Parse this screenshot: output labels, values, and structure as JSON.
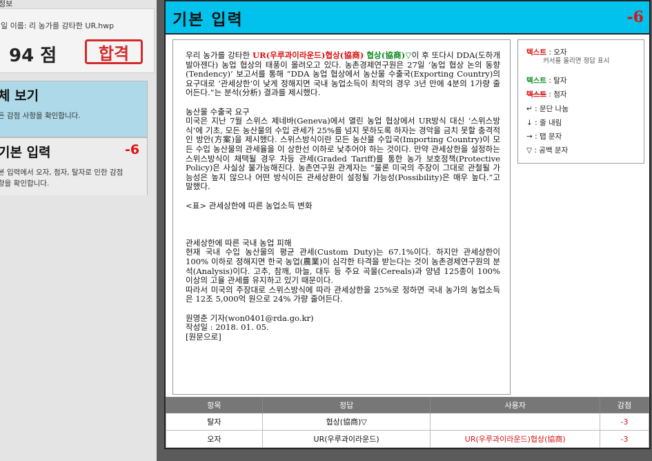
{
  "sidebar": {
    "header": "정보",
    "file_name": "일 이름: 리 농가를 강타한 UR.hwp",
    "score": "94 점",
    "stamp": "합격",
    "card_all": {
      "title": "체 보기",
      "desc": "든 감점 사항을 확인합니다."
    },
    "card_basic": {
      "title": "기본 입력",
      "score": "-6",
      "desc1": "본 입력에서 오자, 첨자, 탈자로 인한 감점",
      "desc2": "항을 확인합니다."
    }
  },
  "main": {
    "title": "기본 입력",
    "penalty": "-6"
  },
  "doc": {
    "p1_a": "우리 농가를 강타한 ",
    "p1_err": "UR(우루과이라운드)협상(協商)",
    "p1_sp": " ",
    "p1_err2": "협상(協商)▽",
    "p1_b": "이 후 또다시 DDA(도하개발아젠다) 농업 협상의 태풍이 몰려오고 있다. 농촌경제연구원은 27일 ‘농업 협상 논의 동향(Tendency)’ 보고서를 통해 “DDA 농업 협상에서 농산물 수출국(Exporting Country)의 요구대로 ‘관세상한’이 낮게 정해지면 국내 농업소득이 최악의 경우 3년 만에 4분의 1가량 줄어든다.”는 분석(分析) 결과를 제시했다.",
    "p2": "농산물 수출국 요구",
    "p3": "미국은 지난 7월 스위스 제네바(Geneva)에서 열린 농업 협상에서 UR방식 대신 ‘스위스방식’에 기초, 모든 농산물의 수입 관세가 25%를 넘지 못하도록 하자는 경악을 금치 못할 충격적인 방안(方案)을 제시했다. 스위스방식이란 모든 농산물 수입국(Importing Country)이 모든 수입 농산물의 관세율을 이 상한선 이하로 낮추어야 하는 것이다. 만약 관세상한을 설정하는 스위스방식이 채택될 경우 차등 관세(Graded Tariff)를 통한 농가 보호정책(Protective Policy)은 사실상 불가능해진다. 농촌연구원 관계자는 “물론 미국의 주장이 그대로 관철될 가능성은 높지 않으나 어떤 방식이든 관세상환이 설정될 가능성(Possibility)은 매우 높다.”고 말했다.",
    "p4": "<표> 관세상한에 따른 농업소득 변화",
    "p5": "관세상한에 따른 국내 농업 피해",
    "p6": "현재 국내 수입 농산물의 평균 관세(Custom Duty)는 67.1%이다. 하지만 관세상한이 100% 이하로 정해지면 한국 농업(農業)이 심각한 타격을 받는다는 것이 농촌경제연구원의 분석(Analysis)이다. 고추, 참깨, 마늘, 대두 등 주요 곡물(Cereals)과 양념 125종이 100% 이상의 고율 관세를 유지하고 있기 때문이다.",
    "p7": "따라서 미국의 주장대로 스위스방식에 따라 관세상한을 25%로 정하면 국내 농가의 농업소득은 12조 5,000억 원으로 24% 가량 줄어든다.",
    "p8": "원영춘 기자(won0401@rda.go.kr)",
    "p9": "작성일 : 2018. 01. 05.",
    "p10": "[원문으로]"
  },
  "legend": {
    "r1_mark": "텍스트",
    "r1_label": " : 오자",
    "r1_sub": "커서를 올리면 정답 표시",
    "r2_mark": "텍스트",
    "r2_label": " : 탈자",
    "r3_mark": "텍스트",
    "r3_label": " : 첨자",
    "r4": "↵ : 문단 나눔",
    "r5": "↓ : 줄 내림",
    "r6": "→ : 탭 문자",
    "r7": "▽ : 공백 문자"
  },
  "table": {
    "headers": [
      "항목",
      "정답",
      "사용자",
      "감점"
    ],
    "rows": [
      {
        "item": "탈자",
        "answer": "협상(協商)▽",
        "user": "",
        "penalty": "-3"
      },
      {
        "item": "오자",
        "answer": "UR(우루과이라운드)",
        "user": "UR(우루과이라운드)협상(協商)",
        "penalty": "-3"
      }
    ]
  },
  "colors": {
    "header_bg": "#00c2ec",
    "error_red": "#d81010",
    "missing_green": "#0b8a1e",
    "card_selected": "#add9e9"
  }
}
